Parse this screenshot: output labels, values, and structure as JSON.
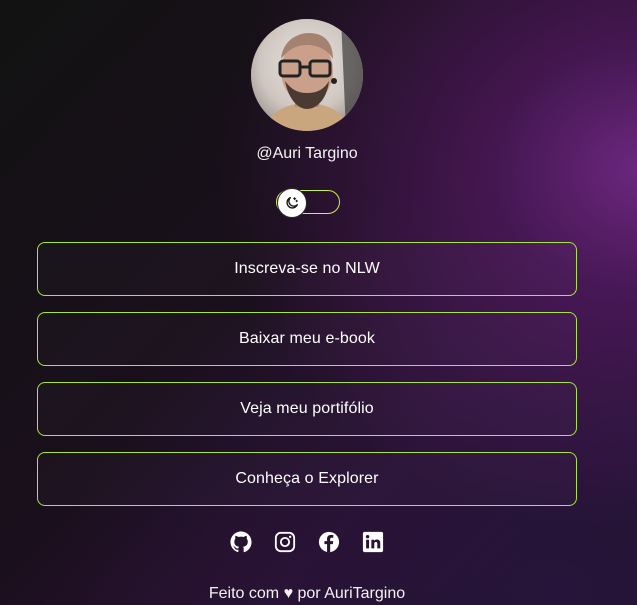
{
  "profile": {
    "username": "@Auri Targino",
    "avatar_icon": "profile-photo"
  },
  "theme_toggle": {
    "state": "dark",
    "icon": "moon-icon"
  },
  "links": [
    {
      "label": "Inscreva-se no NLW"
    },
    {
      "label": "Baixar meu e-book"
    },
    {
      "label": "Veja meu portifólio"
    },
    {
      "label": "Conheça o Explorer"
    }
  ],
  "social": {
    "icons": [
      "github-icon",
      "instagram-icon",
      "facebook-icon",
      "linkedin-icon"
    ]
  },
  "footer": {
    "text": "Feito com ♥ por AuriTargino"
  },
  "colors": {
    "accent": "#a8e63a",
    "background_dark": "#121212",
    "background_purple": "#6e2882"
  }
}
